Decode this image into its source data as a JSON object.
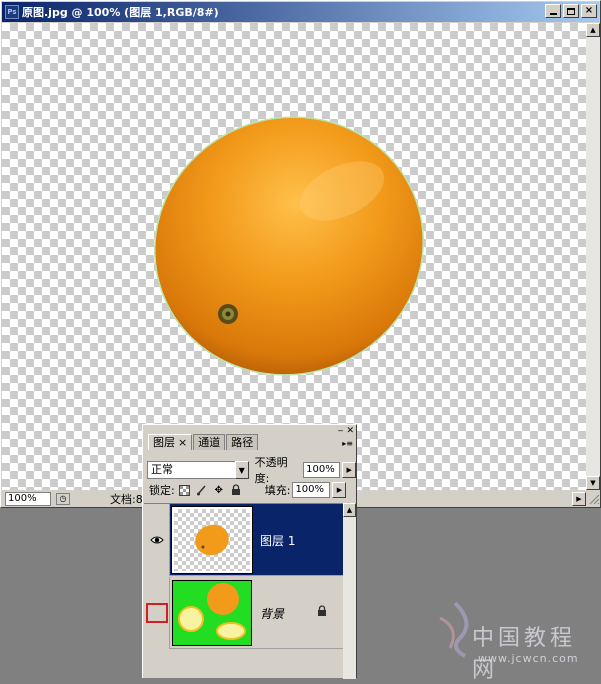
{
  "document": {
    "title": "原图.jpg @ 100% (图层 1,RGB/8#)",
    "icon_label": "Ps",
    "zoom": "100%",
    "status_text": "文档:8"
  },
  "window_controls": {
    "minimize_icon": "minimize-icon",
    "maximize_icon": "maximize-icon",
    "close_glyph": "×"
  },
  "layers_panel": {
    "tabs": [
      {
        "label": "图层",
        "active": true
      },
      {
        "label": "通道",
        "active": false
      },
      {
        "label": "路径",
        "active": false
      }
    ],
    "tab_close_glyph": "×",
    "blend_mode": "正常",
    "opacity_label": "不透明度:",
    "opacity_value": "100%",
    "lock_label": "锁定:",
    "fill_label": "填充:",
    "fill_value": "100%",
    "layers": [
      {
        "name": "图层 1",
        "visible": true,
        "selected": true,
        "locked": false
      },
      {
        "name": "背景",
        "visible": false,
        "selected": false,
        "locked": true
      }
    ]
  },
  "watermark": {
    "text": "中国教程网",
    "url": "www.jcwcn.com"
  },
  "colors": {
    "titlebar_start": "#0a246a",
    "titlebar_end": "#a6caf0",
    "selected_layer": "#0a246a",
    "orange": "#f29a1a",
    "green_bg": "#22dd22",
    "highlight_box": "#d02020"
  }
}
